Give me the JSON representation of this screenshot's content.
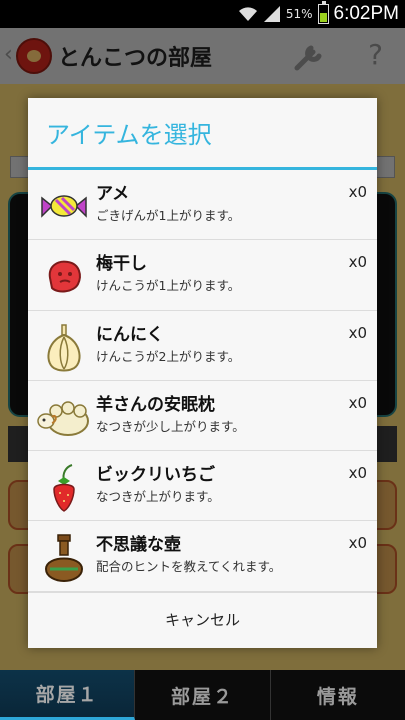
{
  "status_bar": {
    "battery_pct": "51%",
    "time": "6:02PM"
  },
  "action_bar": {
    "title": "とんこつの部屋",
    "back_glyph": "‹",
    "help_glyph": "?"
  },
  "dialog": {
    "title": "アイテムを選択",
    "items": [
      {
        "icon": "candy-icon",
        "name": "アメ",
        "desc": "ごきげんが1上がります。",
        "count": "x0"
      },
      {
        "icon": "umeboshi-icon",
        "name": "梅干し",
        "desc": "けんこうが1上がります。",
        "count": "x0"
      },
      {
        "icon": "garlic-icon",
        "name": "にんにく",
        "desc": "けんこうが2上がります。",
        "count": "x0"
      },
      {
        "icon": "sheep-pillow-icon",
        "name": "羊さんの安眠枕",
        "desc": "なつきが少し上がります。",
        "count": "x0"
      },
      {
        "icon": "strawberry-icon",
        "name": "ビックリいちご",
        "desc": "なつきが上がります。",
        "count": "x0"
      },
      {
        "icon": "pot-icon",
        "name": "不思議な壺",
        "desc": "配合のヒントを教えてくれます。",
        "count": "x0"
      }
    ],
    "cancel_label": "キャンセル"
  },
  "tabs": [
    {
      "label": "部屋１",
      "active": true
    },
    {
      "label": "部屋２",
      "active": false
    },
    {
      "label": "情報",
      "active": false
    }
  ],
  "colors": {
    "accent": "#35b5de",
    "battery": "#9bd11f"
  }
}
